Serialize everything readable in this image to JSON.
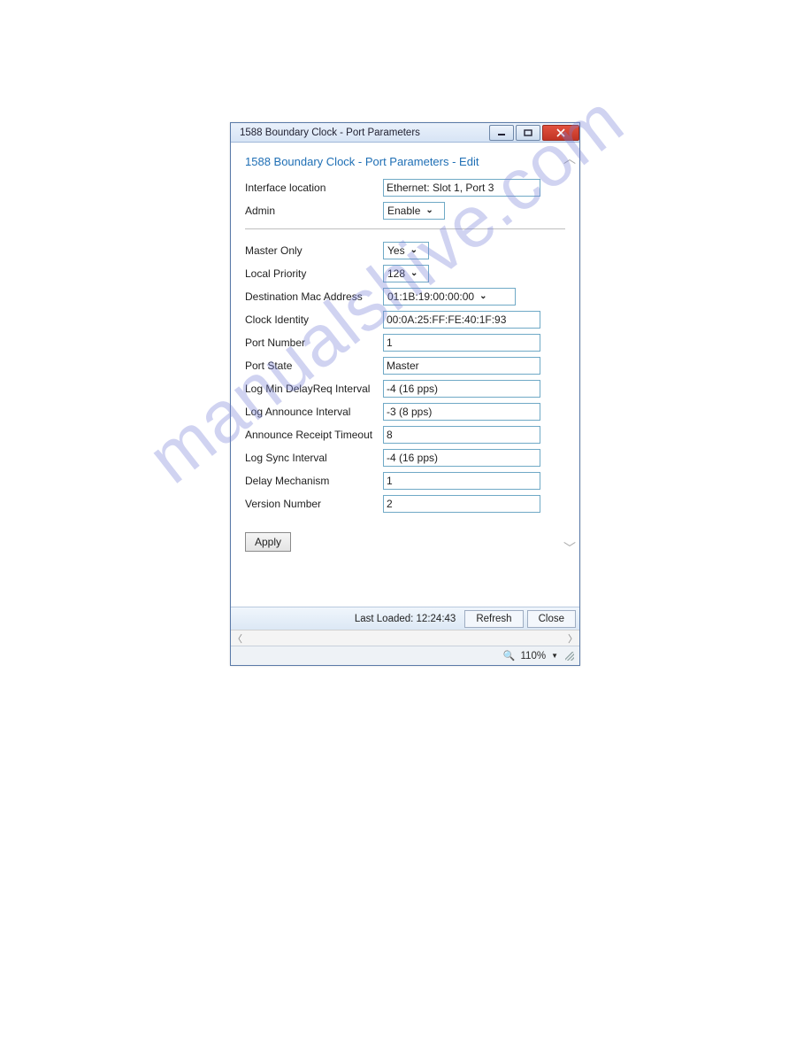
{
  "watermark": "manualshive.com",
  "window": {
    "title": "1588 Boundary Clock - Port Parameters"
  },
  "heading": "1588 Boundary Clock - Port Parameters - Edit",
  "top_fields": {
    "interface_location": {
      "label": "Interface location",
      "value": "Ethernet: Slot 1, Port 3"
    },
    "admin": {
      "label": "Admin",
      "value": "Enable"
    }
  },
  "fields": {
    "master_only": {
      "label": "Master Only",
      "value": "Yes"
    },
    "local_priority": {
      "label": "Local Priority",
      "value": "128"
    },
    "dest_mac": {
      "label": "Destination Mac Address",
      "value": "01:1B:19:00:00:00"
    },
    "clock_identity": {
      "label": "Clock Identity",
      "value": "00:0A:25:FF:FE:40:1F:93"
    },
    "port_number": {
      "label": "Port Number",
      "value": "1"
    },
    "port_state": {
      "label": "Port State",
      "value": "Master"
    },
    "log_min_delayreq": {
      "label": "Log Min DelayReq Interval",
      "value": "-4 (16 pps)"
    },
    "log_announce": {
      "label": "Log Announce Interval",
      "value": "-3 (8 pps)"
    },
    "announce_timeout": {
      "label": "Announce Receipt Timeout",
      "value": "8"
    },
    "log_sync": {
      "label": "Log Sync Interval",
      "value": "-4 (16 pps)"
    },
    "delay_mech": {
      "label": "Delay Mechanism",
      "value": "1"
    },
    "version": {
      "label": "Version Number",
      "value": "2"
    }
  },
  "buttons": {
    "apply": "Apply",
    "refresh": "Refresh",
    "close": "Close"
  },
  "footer": {
    "last_loaded": "Last Loaded: 12:24:43"
  },
  "status": {
    "zoom": "110%"
  }
}
